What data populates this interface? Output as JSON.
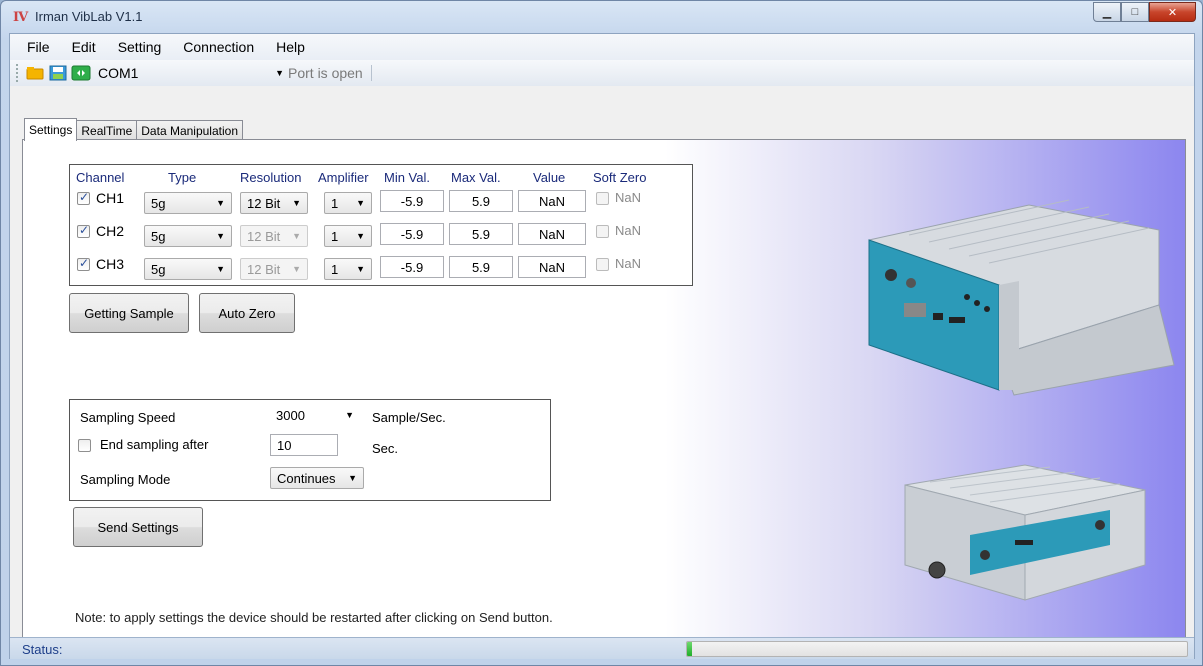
{
  "window": {
    "title": "Irman VibLab V1.1",
    "app_icon_text": "IV"
  },
  "menu": [
    "File",
    "Edit",
    "Setting",
    "Connection",
    "Help"
  ],
  "toolbar": {
    "port": "COM1",
    "port_status": "Port is open",
    "icons": [
      "open-folder-icon",
      "save-icon",
      "connect-icon"
    ]
  },
  "tabs": [
    "Settings",
    "RealTime",
    "Data Manipulation"
  ],
  "active_tab": "Settings",
  "channels": {
    "headers": {
      "channel": "Channel",
      "type": "Type",
      "resolution": "Resolution",
      "amplifier": "Amplifier",
      "min": "Min Val.",
      "max": "Max Val.",
      "value": "Value",
      "soft_zero": "Soft Zero"
    },
    "rows": [
      {
        "name": "CH1",
        "checked": true,
        "type": "5g",
        "resolution": "12 Bit",
        "resolution_enabled": true,
        "amplifier": "1",
        "min": "-5.9",
        "max": "5.9",
        "value": "NaN",
        "soft_zero": "NaN"
      },
      {
        "name": "CH2",
        "checked": true,
        "type": "5g",
        "resolution": "12 Bit",
        "resolution_enabled": false,
        "amplifier": "1",
        "min": "-5.9",
        "max": "5.9",
        "value": "NaN",
        "soft_zero": "NaN"
      },
      {
        "name": "CH3",
        "checked": true,
        "type": "5g",
        "resolution": "12 Bit",
        "resolution_enabled": false,
        "amplifier": "1",
        "min": "-5.9",
        "max": "5.9",
        "value": "NaN",
        "soft_zero": "NaN"
      }
    ]
  },
  "buttons": {
    "getting_sample": "Getting Sample",
    "auto_zero": "Auto Zero",
    "send_settings": "Send Settings"
  },
  "sampling": {
    "speed_label": "Sampling Speed",
    "speed_value": "3000",
    "speed_unit": "Sample/Sec.",
    "end_label": "End sampling after",
    "end_checked": false,
    "end_value": "10",
    "end_unit": "Sec.",
    "mode_label": "Sampling Mode",
    "mode_value": "Continues"
  },
  "note": "Note: to apply settings the device should be restarted after clicking on Send button.",
  "status": {
    "label": "Status:",
    "progress": 0.01
  },
  "colors": {
    "header_text": "#1a2a7a",
    "status_text": "#1e3f8a",
    "device_panel": "#2c9ab8",
    "progress_fill": "#1fae2a"
  }
}
